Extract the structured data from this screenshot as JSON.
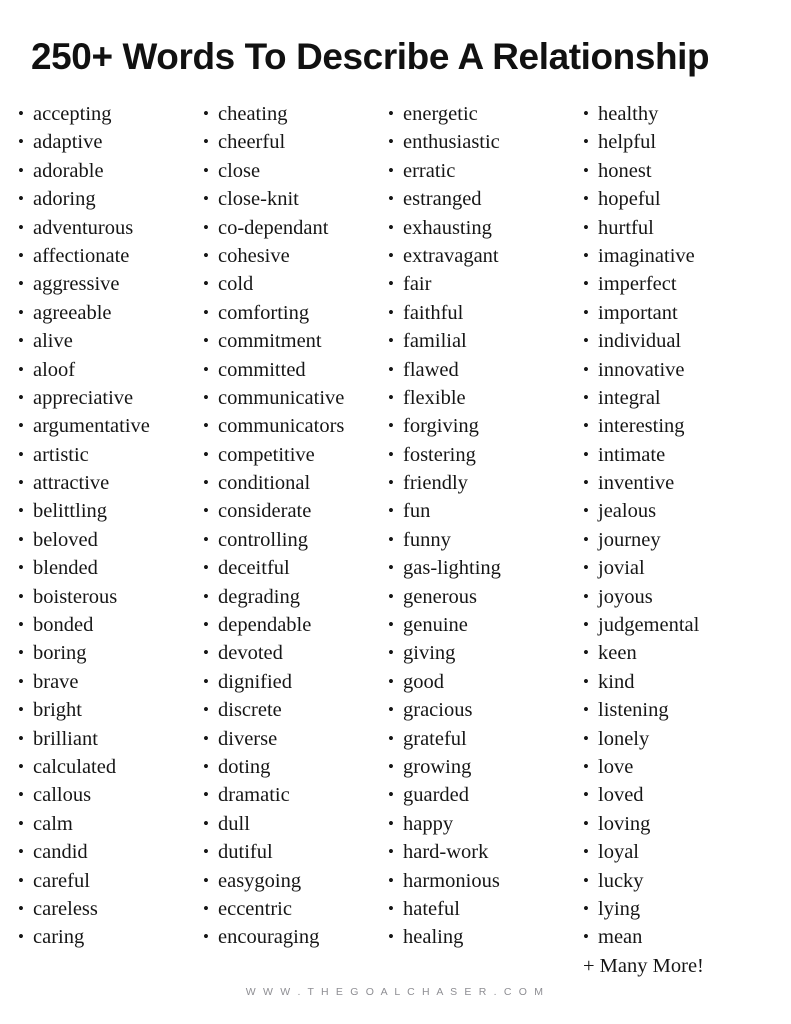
{
  "document": {
    "title": "250+ Words To Describe A Relationship",
    "footer": "W W W . T H E G O A L C H A S E R . C O M",
    "bullet_glyph": "•",
    "many_more_label": "+ Many More!",
    "colors": {
      "text": "#161616",
      "title": "#111111",
      "footer": "#8e8e93",
      "background": "#ffffff"
    }
  },
  "columns": [
    {
      "index": 1,
      "items": [
        "accepting",
        "adaptive",
        "adorable",
        "adoring",
        "adventurous",
        "affectionate",
        "aggressive",
        "agreeable",
        "alive",
        "aloof",
        "appreciative",
        "argumentative",
        "artistic",
        "attractive",
        "belittling",
        "beloved",
        "blended",
        "boisterous",
        "bonded",
        "boring",
        "brave",
        "bright",
        "brilliant",
        "calculated",
        "callous",
        "calm",
        "candid",
        "careful",
        "careless",
        "caring"
      ]
    },
    {
      "index": 2,
      "items": [
        "cheating",
        "cheerful",
        "close",
        "close-knit",
        "co-dependant",
        "cohesive",
        "cold",
        "comforting",
        "commitment",
        "committed",
        "communicative",
        "communicators",
        "competitive",
        "conditional",
        "considerate",
        "controlling",
        "deceitful",
        "degrading",
        "dependable",
        "devoted",
        "dignified",
        "discrete",
        "diverse",
        "doting",
        "dramatic",
        "dull",
        "dutiful",
        "easygoing",
        "eccentric",
        "encouraging"
      ]
    },
    {
      "index": 3,
      "items": [
        "energetic",
        "enthusiastic",
        "erratic",
        "estranged",
        "exhausting",
        "extravagant",
        "fair",
        "faithful",
        "familial",
        "flawed",
        "flexible",
        "forgiving",
        "fostering",
        "friendly",
        "fun",
        "funny",
        "gas-lighting",
        "generous",
        "genuine",
        "giving",
        "good",
        "gracious",
        "grateful",
        "growing",
        "guarded",
        "happy",
        "hard-work",
        "harmonious",
        "hateful",
        "healing"
      ]
    },
    {
      "index": 4,
      "items": [
        "healthy",
        "helpful",
        "honest",
        "hopeful",
        "hurtful",
        "imaginative",
        "imperfect",
        "important",
        "individual",
        "innovative",
        "integral",
        "interesting",
        "intimate",
        "inventive",
        "jealous",
        "journey",
        "jovial",
        "joyous",
        "judgemental",
        "keen",
        "kind",
        "listening",
        "lonely",
        "love",
        "loved",
        "loving",
        "loyal",
        "lucky",
        "lying",
        "mean"
      ]
    }
  ]
}
